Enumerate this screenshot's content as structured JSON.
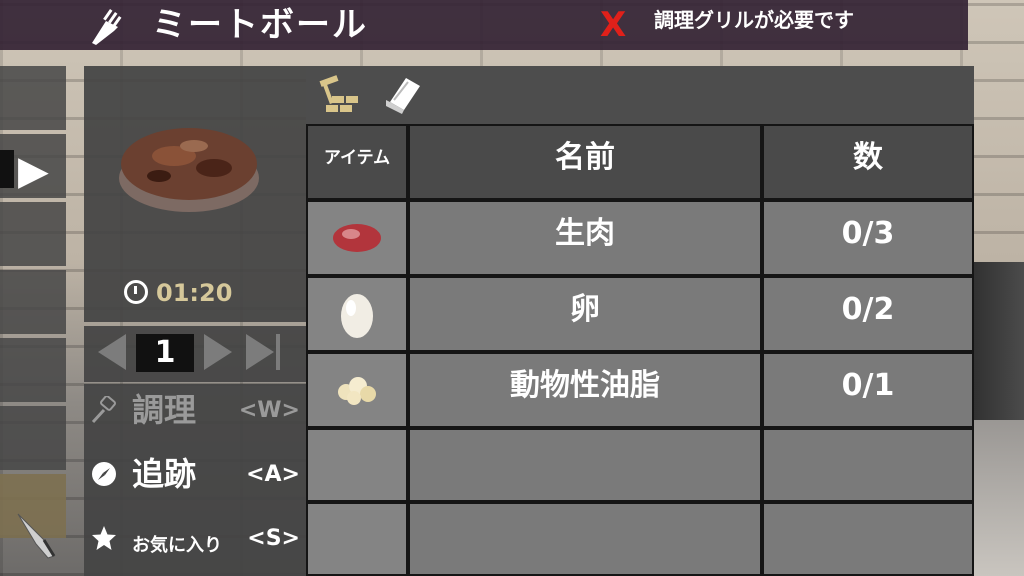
{
  "header": {
    "title": "ミートボール",
    "status_mark": "X",
    "requirement": "調理グリルが必要です"
  },
  "item": {
    "icon": "meatball-patty-image",
    "craft_time": "01:20"
  },
  "quantity": {
    "value": "1"
  },
  "actions": [
    {
      "label": "調理",
      "key": "<W>",
      "icon": "spatula-icon",
      "enabled": false
    },
    {
      "label": "追跡",
      "key": "<A>",
      "icon": "compass-icon",
      "enabled": true
    },
    {
      "label": "お気に入り",
      "key": "<S>",
      "icon": "star-icon",
      "enabled": true
    }
  ],
  "tabs": [
    {
      "icon": "hammer-bricks-icon"
    },
    {
      "icon": "book-icon"
    }
  ],
  "table": {
    "headers": {
      "item": "アイテム",
      "name": "名前",
      "count": "数"
    },
    "rows": [
      {
        "icon": "raw-meat-icon",
        "name": "生肉",
        "count": "0/3"
      },
      {
        "icon": "egg-icon",
        "name": "卵",
        "count": "0/2"
      },
      {
        "icon": "animal-fat-icon",
        "name": "動物性油脂",
        "count": "0/1"
      },
      {
        "icon": "",
        "name": "",
        "count": ""
      },
      {
        "icon": "",
        "name": "",
        "count": ""
      }
    ]
  },
  "colors": {
    "accent_gold": "#d6c89a",
    "warning_red": "#e0201a",
    "title_bar": "#342334"
  }
}
